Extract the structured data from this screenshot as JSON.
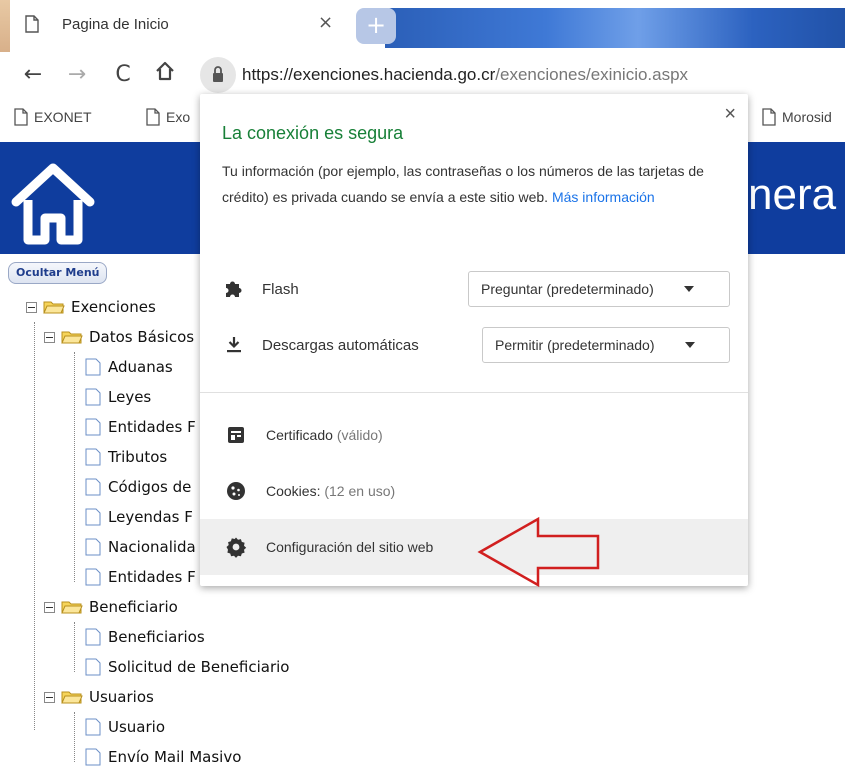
{
  "browser": {
    "tab": {
      "title": "Pagina de Inicio",
      "close": "×"
    },
    "new_tab": "+",
    "nav": {
      "back": "←",
      "forward": "→",
      "reload": "C",
      "home": "⌂"
    },
    "url": {
      "host": "https://exenciones.hacienda.go.cr",
      "path": "/exenciones/exinicio.aspx"
    },
    "bookmarks": [
      "EXONET",
      "Exo",
      "Morosid"
    ]
  },
  "page": {
    "header_text": "nera",
    "toggle_menu_label": "Ocultar Menú",
    "tree": {
      "root": "Exenciones",
      "groups": [
        {
          "label": "Datos Básicos",
          "items": [
            "Aduanas",
            "Leyes",
            "Entidades F",
            "Tributos",
            "Códigos de",
            "Leyendas F",
            "Nacionalida",
            "Entidades F"
          ]
        },
        {
          "label": "Beneficiario",
          "items": [
            "Beneficiarios",
            "Solicitud de Beneficiario"
          ]
        },
        {
          "label": "Usuarios",
          "items": [
            "Usuario",
            "Envío Mail Masivo"
          ]
        }
      ]
    }
  },
  "popup": {
    "close": "×",
    "title": "La conexión es segura",
    "description": "Tu información (por ejemplo, las contraseñas o los números de las tarjetas de crédito) es privada cuando se envía a este sitio web.",
    "link": "Más información",
    "permissions": [
      {
        "icon": "puzzle-icon",
        "label": "Flash",
        "value": "Preguntar (predeterminado)"
      },
      {
        "icon": "download-icon",
        "label": "Descargas automáticas",
        "value": "Permitir (predeterminado)"
      }
    ],
    "certificate": {
      "label": "Certificado",
      "status": "(válido)"
    },
    "cookies": {
      "label": "Cookies:",
      "status": "(12 en uso)"
    },
    "site_settings": "Configuración del sitio web"
  },
  "colors": {
    "secure_green": "#188038",
    "link_blue": "#1a73e8",
    "header_blue": "#0f3d9e",
    "annotation_red": "#d11f1f"
  }
}
